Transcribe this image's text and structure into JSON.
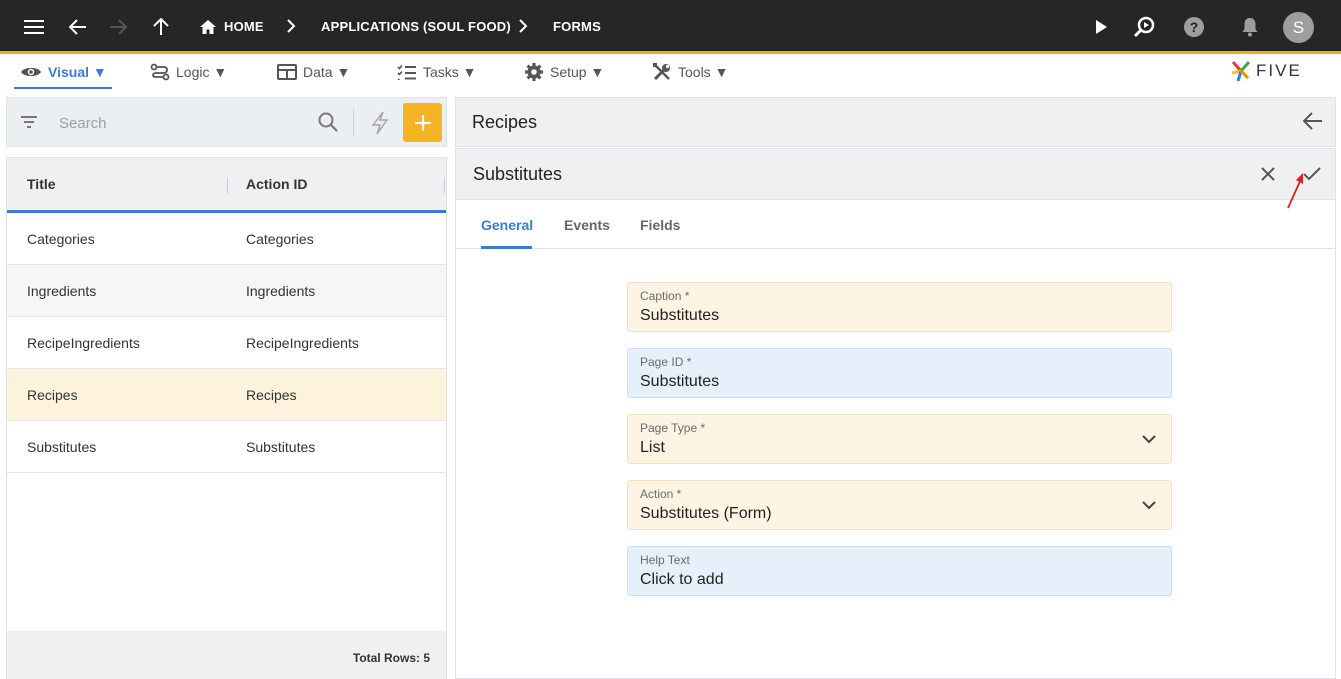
{
  "topbar": {
    "breadcrumbs": [
      "HOME",
      "APPLICATIONS (SOUL FOOD)",
      "FORMS"
    ],
    "avatar_letter": "S",
    "accent_color": "#f5a91c"
  },
  "menu": {
    "items": [
      {
        "label": "Visual ▼",
        "icon": "eye-icon"
      },
      {
        "label": "Logic ▼",
        "icon": "flow-icon"
      },
      {
        "label": "Data ▼",
        "icon": "table-icon"
      },
      {
        "label": "Tasks ▼",
        "icon": "checklist-icon"
      },
      {
        "label": "Setup ▼",
        "icon": "gear-icon"
      },
      {
        "label": "Tools ▼",
        "icon": "tools-icon"
      }
    ],
    "logo_text": "FIVE"
  },
  "list": {
    "search_placeholder": "Search",
    "columns": [
      "Title",
      "Action ID"
    ],
    "rows": [
      [
        "Categories",
        "Categories"
      ],
      [
        "Ingredients",
        "Ingredients"
      ],
      [
        "RecipeIngredients",
        "RecipeIngredients"
      ],
      [
        "Recipes",
        "Recipes"
      ],
      [
        "Substitutes",
        "Substitutes"
      ]
    ],
    "total_rows": "Total Rows: 5"
  },
  "detail": {
    "parent_title": "Recipes",
    "form_title": "Substitutes",
    "tabs": [
      "General",
      "Events",
      "Fields"
    ],
    "fields": [
      {
        "label": "Caption *",
        "value": "Substitutes"
      },
      {
        "label": "Page ID *",
        "value": "Substitutes"
      },
      {
        "label": "Page Type *",
        "value": "List"
      },
      {
        "label": "Action *",
        "value": "Substitutes (Form)"
      },
      {
        "label": "Help Text",
        "value": "Click to add"
      }
    ]
  }
}
